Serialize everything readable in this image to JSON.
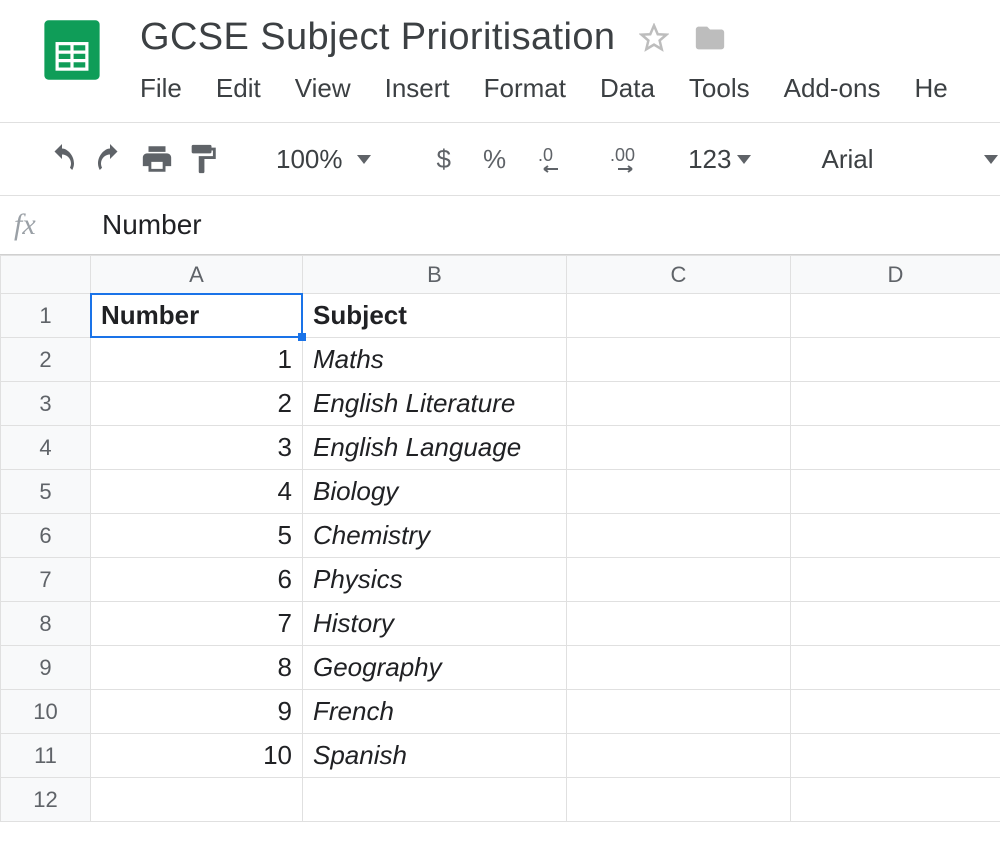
{
  "doc": {
    "title": "GCSE Subject Prioritisation"
  },
  "menu": {
    "file": "File",
    "edit": "Edit",
    "view": "View",
    "insert": "Insert",
    "format": "Format",
    "data": "Data",
    "tools": "Tools",
    "addons": "Add-ons",
    "help": "He"
  },
  "toolbar": {
    "zoom": "100%",
    "currency": "$",
    "percent": "%",
    "dec_decrease": ".0",
    "dec_increase": ".00",
    "numformat": "123",
    "font": "Arial"
  },
  "formula_bar": {
    "fx": "fx",
    "value": "Number"
  },
  "columns": {
    "A": "A",
    "B": "B",
    "C": "C",
    "D": "D"
  },
  "rows": [
    "1",
    "2",
    "3",
    "4",
    "5",
    "6",
    "7",
    "8",
    "9",
    "10",
    "11",
    "12"
  ],
  "sheet": {
    "selected_cell": "A1",
    "headers": {
      "a": "Number",
      "b": "Subject"
    },
    "data": [
      {
        "n": "1",
        "s": "Maths"
      },
      {
        "n": "2",
        "s": "English Literature"
      },
      {
        "n": "3",
        "s": "English Language"
      },
      {
        "n": "4",
        "s": "Biology"
      },
      {
        "n": "5",
        "s": "Chemistry"
      },
      {
        "n": "6",
        "s": "Physics"
      },
      {
        "n": "7",
        "s": "History"
      },
      {
        "n": "8",
        "s": "Geography"
      },
      {
        "n": "9",
        "s": "French"
      },
      {
        "n": "10",
        "s": "Spanish"
      }
    ]
  }
}
